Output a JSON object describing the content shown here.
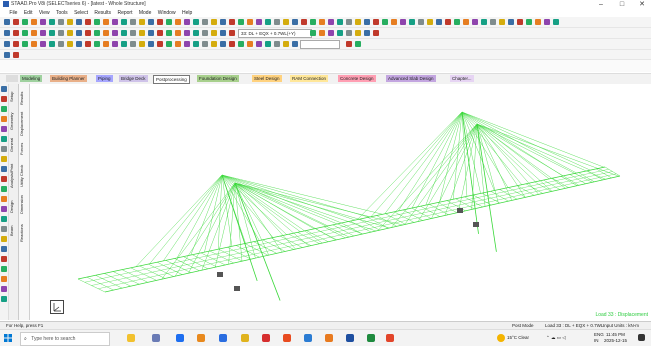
{
  "window": {
    "title": "STAAD.Pro V8i (SELECTseries 6) - [latest - Whole Structure]"
  },
  "menu": [
    "File",
    "Edit",
    "View",
    "Tools",
    "Select",
    "Results",
    "Report",
    "Mode",
    "Window",
    "Help"
  ],
  "toolbar": {
    "load_combo": "33: DL + EQX + 0.7WL(+Y)",
    "unit_combo": ""
  },
  "tabs": [
    "Modeling",
    "Building Planner",
    "Piping",
    "Bridge Deck",
    "Postprocessing",
    "Foundation Design",
    "Steel Design",
    "RAM Connection",
    "Concrete Design",
    "Advanced Slab Design",
    "Chapter..."
  ],
  "tab_colors": [
    "#9fd19f",
    "#e9b089",
    "#a6a6ff",
    "#cfc3e9",
    "#ffffff",
    "#a8d08d",
    "#ffd27f",
    "#ffe79a",
    "#ff9fb3",
    "#c3a6e0",
    "#e6d4f3"
  ],
  "active_tab": "Postprocessing",
  "side_tabs": [
    "Setup",
    "Geometry",
    "General",
    "Analysis/Print",
    "Design",
    "Beam"
  ],
  "panel2_tabs": [
    "Results",
    "Displacement",
    "Forces",
    "Utility Check",
    "Dimension",
    "Reactions"
  ],
  "viewport": {
    "load_label": "Load 33 : Displacement",
    "model_color": "#39d839"
  },
  "status": {
    "left": "For Help, press F1",
    "mode": "Post Mode",
    "load": "Load 33 : DL + EQX + 0.7WL",
    "units": "Input Units : kN-m"
  },
  "taskbar": {
    "search_placeholder": "Type here to search",
    "weather": "15°C Clear",
    "lang": "ENG",
    "region": "IN",
    "time": "11:45 PM",
    "date": "2025-12-15"
  }
}
